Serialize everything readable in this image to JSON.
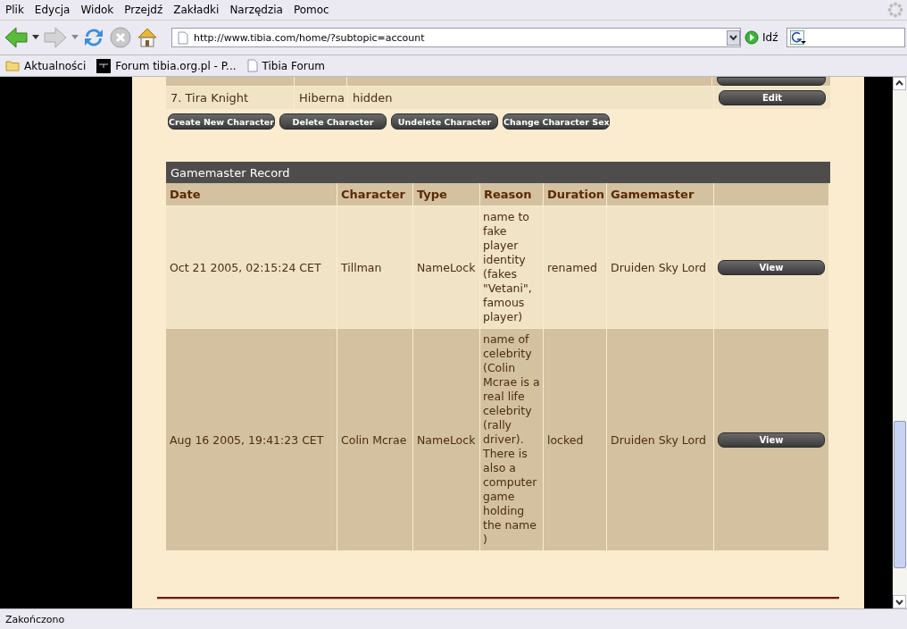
{
  "menu": [
    "Plik",
    "Edycja",
    "Widok",
    "Przejdź",
    "Zakładki",
    "Narzędzia",
    "Pomoc"
  ],
  "address": {
    "value": "http://www.tibia.com/home/?subtopic=account"
  },
  "go_label": "Idź",
  "bookmarks": [
    {
      "label": "Aktualności",
      "kind": "folder"
    },
    {
      "label": "Forum tibia.org.pl - P...",
      "kind": "site"
    },
    {
      "label": "Tibia Forum",
      "kind": "page"
    }
  ],
  "characters": [
    {
      "name": "7. Tira Knight",
      "world": "Hiberna",
      "status": "hidden",
      "button": "Edit"
    }
  ],
  "character_buttons": [
    "Create New Character",
    "Delete Character",
    "Undelete Character",
    "Change Character Sex"
  ],
  "gm_record": {
    "title": "Gamemaster Record",
    "columns": [
      "Date",
      "Character",
      "Type",
      "Reason",
      "Duration",
      "Gamemaster"
    ],
    "rows": [
      {
        "date": "Oct 21 2005, 02:15:24 CET",
        "character": "Tillman",
        "type": "NameLock",
        "reason": "name to fake player identity (fakes \"Vetani\", famous player)",
        "duration": "renamed",
        "gamemaster": "Druiden Sky Lord",
        "button": "View"
      },
      {
        "date": "Aug 16 2005, 19:41:23 CET",
        "character": "Colin Mcrae",
        "type": "NameLock",
        "reason": "name of celebrity (Colin Mcrae is a real life celebrity (rally driver). There is also a computer game holding the name )",
        "duration": "locked",
        "gamemaster": "Druiden Sky Lord",
        "button": "View"
      }
    ]
  },
  "status_bar": "Zakończono"
}
